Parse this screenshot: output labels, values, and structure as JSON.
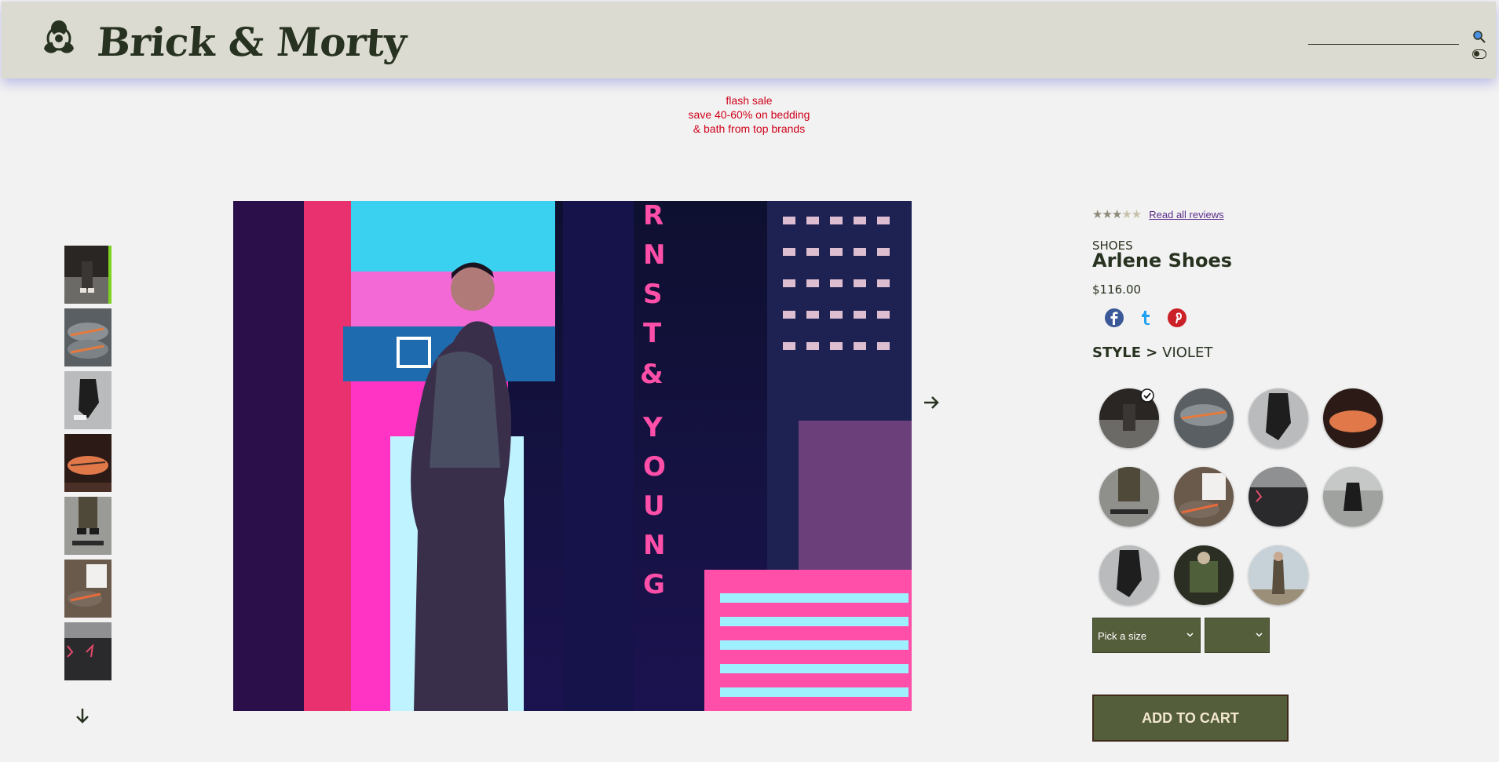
{
  "header": {
    "brand": "Brick & Morty",
    "logo_icon": "biohazard-icon",
    "search_icon": "search-icon",
    "theme_toggle_icon": "toggle-icon"
  },
  "promo": {
    "line1": "flash sale",
    "line2": "save 40-60% on bedding",
    "line3": "& bath from top brands"
  },
  "gallery": {
    "thumbnails": [
      {
        "alt": "thumbnail-1",
        "active": true
      },
      {
        "alt": "thumbnail-2",
        "active": false
      },
      {
        "alt": "thumbnail-3",
        "active": false
      },
      {
        "alt": "thumbnail-4",
        "active": false
      },
      {
        "alt": "thumbnail-5",
        "active": false
      },
      {
        "alt": "thumbnail-6",
        "active": false
      },
      {
        "alt": "thumbnail-7",
        "active": false
      }
    ],
    "down_icon": "arrow-down-icon",
    "next_icon": "arrow-right-icon"
  },
  "product": {
    "rating": 3,
    "rating_max": 5,
    "reviews_link": "Read all reviews",
    "category": "SHOES",
    "name": "Arlene Shoes",
    "price": "$116.00",
    "social": [
      "facebook-icon",
      "tumblr-icon",
      "pinterest-icon"
    ],
    "style_label": "STYLE >",
    "style_value": "VIOLET",
    "styles_count": 11,
    "selected_style": 0,
    "size_placeholder": "Pick a size",
    "quantity_value": "",
    "add_to_cart": "ADD TO CART"
  },
  "colors": {
    "accent": "#555e3b",
    "promo": "#d0021b",
    "header_bg": "#dcdbd2",
    "active_thumb": "#7ed321"
  }
}
